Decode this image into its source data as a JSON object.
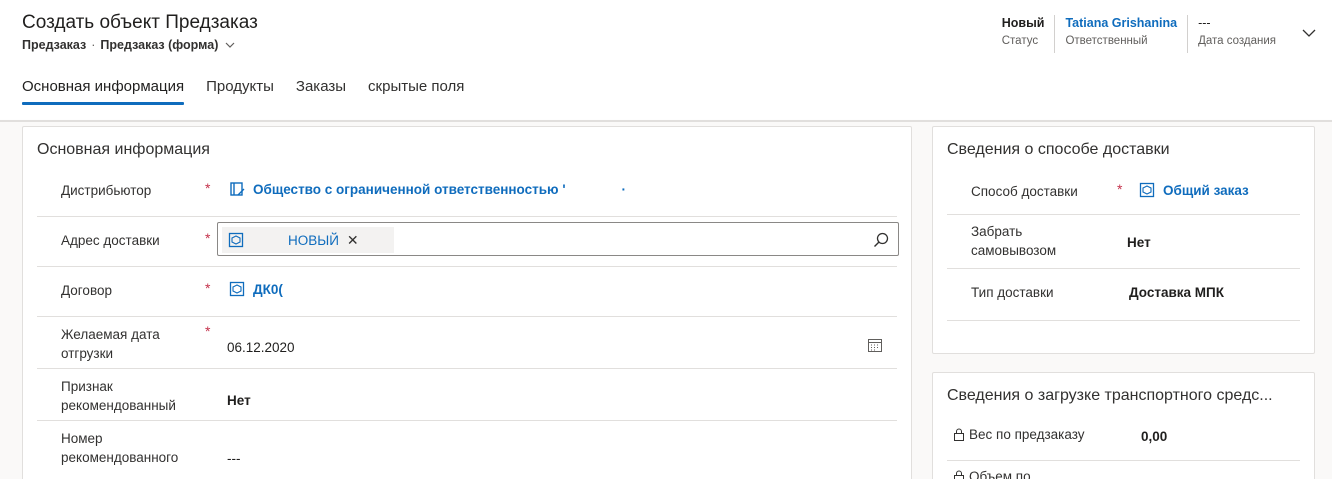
{
  "header": {
    "title": "Создать объект Предзаказ",
    "entity": "Предзаказ",
    "separator": "·",
    "form_name": "Предзаказ (форма)",
    "status_value": "Новый",
    "status_label": "Статус",
    "owner_value": "Tatiana Grishanina",
    "owner_label": "Ответственный",
    "created_value": "---",
    "created_label": "Дата создания"
  },
  "tabs": [
    {
      "label": "Основная информация",
      "active": true
    },
    {
      "label": "Продукты",
      "active": false
    },
    {
      "label": "Заказы",
      "active": false
    },
    {
      "label": "скрытые поля",
      "active": false
    }
  ],
  "main_section": {
    "title": "Основная информация",
    "fields": {
      "distributor": {
        "label": "Дистрибьютор",
        "required": "*",
        "value": "Общество с ограниченной ответственностью '"
      },
      "address": {
        "label": "Адрес доставки",
        "required": "*",
        "chip_text": "НОВЫЙ",
        "chip_close": "✕"
      },
      "contract": {
        "label": "Договор",
        "required": "*",
        "value": "ДК0("
      },
      "ship_date": {
        "label": "Желаемая дата отгрузки",
        "required": "*",
        "value": "06.12.2020"
      },
      "recommended": {
        "label": "Признак рекомендованный",
        "value": "Нет"
      },
      "rec_number": {
        "label": "Номер рекомендованного",
        "value": "---"
      }
    }
  },
  "delivery_section": {
    "title": "Сведения о способе доставки",
    "method": {
      "label": "Способ доставки",
      "required": "*",
      "value": "Общий заказ"
    },
    "pickup": {
      "label": "Забрать самовывозом",
      "value": "Нет"
    },
    "type": {
      "label": "Тип доставки",
      "value": "Доставка МПК"
    }
  },
  "loading_section": {
    "title": "Сведения о загрузке транспортного средс...",
    "weight": {
      "label": "Вес по предзаказу",
      "value": "0,00"
    },
    "volume": {
      "label": "Объем по"
    }
  },
  "colors": {
    "accent": "#0f6cbd",
    "required": "#c4314b",
    "border": "#e1dfdd"
  }
}
